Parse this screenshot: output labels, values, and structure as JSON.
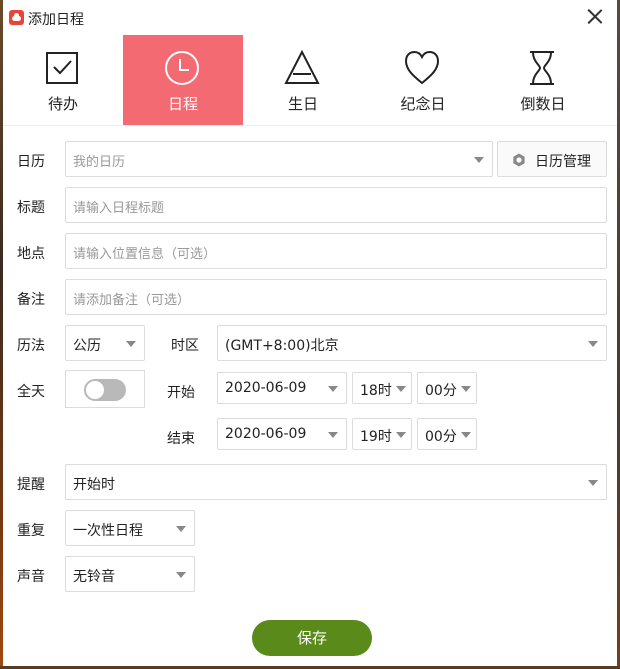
{
  "window": {
    "title": "添加日程"
  },
  "tabs": [
    {
      "label": "待办",
      "icon": "checkbox-icon",
      "active": false
    },
    {
      "label": "日程",
      "icon": "clock-icon",
      "active": true
    },
    {
      "label": "生日",
      "icon": "triangle-icon",
      "active": false
    },
    {
      "label": "纪念日",
      "icon": "heart-icon",
      "active": false
    },
    {
      "label": "倒数日",
      "icon": "hourglass-icon",
      "active": false
    }
  ],
  "form": {
    "calendar": {
      "label": "日历",
      "value": "我的日历",
      "manage_label": "日历管理"
    },
    "title": {
      "label": "标题",
      "placeholder": "请输入日程标题"
    },
    "location": {
      "label": "地点",
      "placeholder": "请输入位置信息（可选）"
    },
    "note": {
      "label": "备注",
      "placeholder": "请添加备注（可选）"
    },
    "calendar_type": {
      "label": "历法",
      "value": "公历"
    },
    "timezone": {
      "label": "时区",
      "value": "(GMT+8:00)北京"
    },
    "all_day": {
      "label": "全天",
      "on": false
    },
    "start": {
      "label": "开始",
      "date": "2020-06-09",
      "hour": "18时",
      "minute": "00分"
    },
    "end": {
      "label": "结束",
      "date": "2020-06-09",
      "hour": "19时",
      "minute": "00分"
    },
    "reminder": {
      "label": "提醒",
      "value": "开始时"
    },
    "repeat": {
      "label": "重复",
      "value": "一次性日程"
    },
    "sound": {
      "label": "声音",
      "value": "无铃音"
    }
  },
  "save_label": "保存",
  "colors": {
    "accent_tab": "#f46a73",
    "save_button": "#5a8a1a"
  }
}
